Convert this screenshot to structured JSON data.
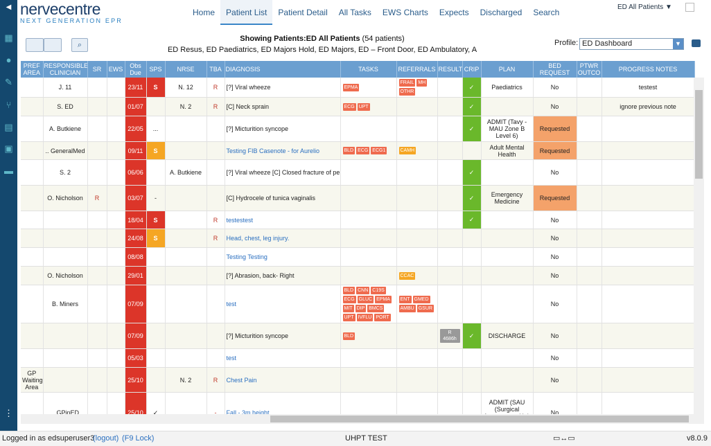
{
  "app": {
    "logo_title": "nervecentre",
    "logo_subtitle": "NEXT GENERATION EPR"
  },
  "nav": [
    "Home",
    "Patient List",
    "Patient Detail",
    "All Tasks",
    "EWS Charts",
    "Expects",
    "Discharged",
    "Search"
  ],
  "nav_active": "Patient List",
  "location_filter": "ED All Patients",
  "showing": {
    "label": "Showing Patients:ED All Patients",
    "count": "(54 patients)",
    "areas": "ED Resus, ED Paediatrics, ED Majors Hold, ED Majors, ED – Front Door, ED Ambulatory, A"
  },
  "profile": {
    "label": "Profile:",
    "value": "ED Dashboard"
  },
  "columns": [
    "PREF AREA",
    "RESPONSIBLE CLINICIAN",
    "SR",
    "EWS",
    "Obs Due",
    "SPS",
    "NRSE",
    "TBA",
    "DIAGNOSIS",
    "TASKS",
    "REFERRALS",
    "RESULT",
    "CRIP",
    "PLAN",
    "BED REQUEST",
    "PTWR OUTCO",
    "PROGRESS NOTES"
  ],
  "rows": [
    {
      "pref": "",
      "clin": "J. 11",
      "sr": "",
      "ews": "",
      "obs": "23/11",
      "sps": "S",
      "sps_color": "red",
      "nrse": "N. 12",
      "tba": "R",
      "diag": "[?] Viral wheeze",
      "link": false,
      "tasks": [
        "EPMA"
      ],
      "refs": [
        "FRAIL",
        "MH",
        "OTHR"
      ],
      "result": "",
      "crip": true,
      "plan": "Paediatrics",
      "bed": "No",
      "ptwr": "",
      "notes": "testest"
    },
    {
      "pref": "",
      "clin": "S. ED",
      "sr": "",
      "ews": "",
      "obs": "01/07",
      "sps": "",
      "sps_color": "none",
      "nrse": "N. 2",
      "tba": "R",
      "diag": "[C] Neck sprain",
      "link": false,
      "tasks": [
        "ECG",
        "UPT"
      ],
      "refs": [],
      "result": "",
      "crip": true,
      "plan": "",
      "bed": "No",
      "ptwr": "",
      "notes": "ignore previous note"
    },
    {
      "pref": "",
      "clin": "A. Butkiene",
      "sr": "",
      "ews": "",
      "obs": "22/05",
      "sps": "...",
      "sps_color": "none",
      "nrse": "",
      "tba": "",
      "diag": "[?] Micturition syncope",
      "link": false,
      "tasks": [],
      "refs": [],
      "result": "",
      "crip": true,
      "plan": "ADMIT (Tavy - MAU Zone B Level 6)",
      "bed": "Requested",
      "ptwr": "",
      "notes": ""
    },
    {
      "pref": "",
      "clin": ".. GeneralMed",
      "sr": "",
      "ews": "",
      "obs": "09/11",
      "sps": "S",
      "sps_color": "yellow",
      "nrse": "",
      "tba": "",
      "diag": "Testing FIB Casenote - for Aurelio",
      "link": true,
      "tasks": [
        "BLD",
        "ECG",
        "ECG1"
      ],
      "refs": [
        "CAMH"
      ],
      "result": "",
      "crip": false,
      "plan": "Adult Mental Health",
      "bed": "Requested",
      "ptwr": "",
      "notes": ""
    },
    {
      "pref": "",
      "clin": "S. 2",
      "sr": "",
      "ews": "",
      "obs": "06/06",
      "sps": "",
      "sps_color": "none",
      "nrse": "A. Butkiene",
      "tba": "",
      "diag": "[?] Viral wheeze [C] Closed fracture of pe",
      "link": false,
      "tasks": [],
      "refs": [],
      "result": "",
      "crip": true,
      "plan": "",
      "bed": "No",
      "ptwr": "",
      "notes": ""
    },
    {
      "pref": "",
      "clin": "O. Nicholson",
      "sr": "R",
      "ews": "",
      "obs": "03/07",
      "sps": "-",
      "sps_color": "none",
      "nrse": "",
      "tba": "",
      "diag": "[C] Hydrocele of tunica vaginalis",
      "link": false,
      "tasks": [],
      "refs": [],
      "result": "",
      "crip": true,
      "plan": "Emergency Medicine",
      "bed": "Requested",
      "ptwr": "",
      "notes": ""
    },
    {
      "pref": "",
      "clin": "",
      "sr": "",
      "ews": "",
      "obs": "18/04",
      "sps": "S",
      "sps_color": "red",
      "nrse": "",
      "tba": "R",
      "diag": "testestest",
      "link": true,
      "tasks": [],
      "refs": [],
      "result": "",
      "crip": true,
      "plan": "",
      "bed": "No",
      "ptwr": "",
      "notes": ""
    },
    {
      "pref": "",
      "clin": "",
      "sr": "",
      "ews": "",
      "obs": "24/08",
      "sps": "S",
      "sps_color": "yellow",
      "nrse": "",
      "tba": "R",
      "diag": "Head, chest, leg injury.",
      "link": true,
      "tasks": [],
      "refs": [],
      "result": "",
      "crip": false,
      "plan": "",
      "bed": "No",
      "ptwr": "",
      "notes": ""
    },
    {
      "pref": "",
      "clin": "",
      "sr": "",
      "ews": "",
      "obs": "08/08",
      "sps": "",
      "sps_color": "none",
      "nrse": "",
      "tba": "",
      "diag": "Testing Testing",
      "link": true,
      "tasks": [],
      "refs": [],
      "result": "",
      "crip": false,
      "plan": "",
      "bed": "No",
      "ptwr": "",
      "notes": ""
    },
    {
      "pref": "",
      "clin": "O. Nicholson",
      "sr": "",
      "ews": "",
      "obs": "29/01",
      "sps": "",
      "sps_color": "none",
      "nrse": "",
      "tba": "",
      "diag": "[?] Abrasion, back- Right",
      "link": false,
      "tasks": [],
      "refs": [
        "CCAC"
      ],
      "result": "",
      "crip": false,
      "plan": "",
      "bed": "No",
      "ptwr": "",
      "notes": ""
    },
    {
      "pref": "",
      "clin": "B. Miners",
      "sr": "",
      "ews": "",
      "obs": "07/09",
      "sps": "",
      "sps_color": "none",
      "nrse": "",
      "tba": "",
      "diag": "test",
      "link": true,
      "tasks": [
        "BLD",
        "CNN",
        "C19S",
        "ECG",
        "GLUC",
        "EPMA",
        "MIT",
        "DIP",
        "BMCS",
        "UPT",
        "IVFLU",
        "PORT"
      ],
      "refs": [
        "ENT",
        "GMED",
        "AMBU",
        "GSUR"
      ],
      "result": "",
      "crip": false,
      "plan": "",
      "bed": "No",
      "ptwr": "",
      "notes": ""
    },
    {
      "pref": "",
      "clin": "",
      "sr": "",
      "ews": "",
      "obs": "07/09",
      "sps": "",
      "sps_color": "none",
      "nrse": "",
      "tba": "",
      "diag": "[?] Micturition syncope",
      "link": false,
      "tasks": [
        "BLD"
      ],
      "refs": [],
      "result": "R 4686h",
      "crip": true,
      "plan": "DISCHARGE",
      "bed": "No",
      "ptwr": "",
      "notes": ""
    },
    {
      "pref": "",
      "clin": "",
      "sr": "",
      "ews": "",
      "obs": "05/03",
      "sps": "",
      "sps_color": "none",
      "nrse": "",
      "tba": "",
      "diag": "test",
      "link": true,
      "tasks": [],
      "refs": [],
      "result": "",
      "crip": false,
      "plan": "",
      "bed": "No",
      "ptwr": "",
      "notes": ""
    },
    {
      "pref": "GP Waiting Area",
      "clin": "",
      "sr": "",
      "ews": "",
      "obs": "25/10",
      "sps": "",
      "sps_color": "none",
      "nrse": "N. 2",
      "tba": "R",
      "diag": "Chest Pain",
      "link": true,
      "tasks": [],
      "refs": [],
      "result": "",
      "crip": false,
      "plan": "",
      "bed": "No",
      "ptwr": "",
      "notes": ""
    },
    {
      "pref": "",
      "clin": ".. GPinED",
      "sr": "",
      "ews": "",
      "obs": "25/10",
      "sps": "✓",
      "sps_color": "none",
      "nrse": "",
      "tba": "-",
      "diag": "Fall - 3m height",
      "link": true,
      "tasks": [],
      "refs": [],
      "result": "",
      "crip": false,
      "plan": "ADMIT (SAU (Surgical Assessment Unit Zone A",
      "bed": "No",
      "ptwr": "",
      "notes": ""
    }
  ],
  "crip_mark": "✓",
  "status": {
    "logged_in": "Logged in as edsuperuser3",
    "logout": "(logout)",
    "f9": "(F9 Lock)",
    "center": "UHPT TEST",
    "version": "v8.0.9"
  }
}
